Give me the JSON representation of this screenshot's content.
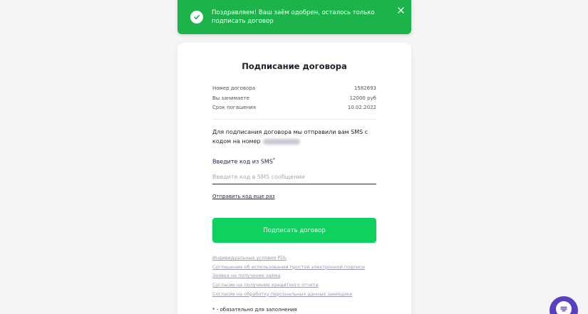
{
  "toast": {
    "message": "Поздравляем! Ваш заём одобрен, осталось только подписать договор",
    "icon": "check-circle-icon",
    "close_icon": "close-icon",
    "color": "#1bb34a"
  },
  "card": {
    "title": "Подписание договора",
    "details": [
      {
        "label": "Номер договора",
        "value": "1582693"
      },
      {
        "label": "Вы занимаете",
        "value": "12000 руб"
      },
      {
        "label": "Срок погашения",
        "value": "10.02.2022"
      }
    ],
    "sms_info": "Для подписания договора мы отправили вам SMS с кодом на номер",
    "code_field": {
      "label": "Введите код из SMS",
      "required_mark": "*",
      "placeholder": "Введите код в SMS сообщении",
      "value": ""
    },
    "resend_link": "Отправить код еще раз",
    "sign_button": "Подписать договор",
    "documents": [
      "Индивидуальные условия PDL",
      "Соглашение об использовании простой электронной подписи",
      "Заявка на получение займа",
      "Согласие на получение кредитного отчета",
      "Согласие на обработку персональных данных заемщика"
    ],
    "required_note": "* - обязательно для заполнения"
  },
  "chat": {
    "icon": "chat-icon",
    "color": "#5a3fc0"
  },
  "colors": {
    "accent_green": "#10d160",
    "link": "#2a2250",
    "doc_link": "#9a97b3"
  }
}
